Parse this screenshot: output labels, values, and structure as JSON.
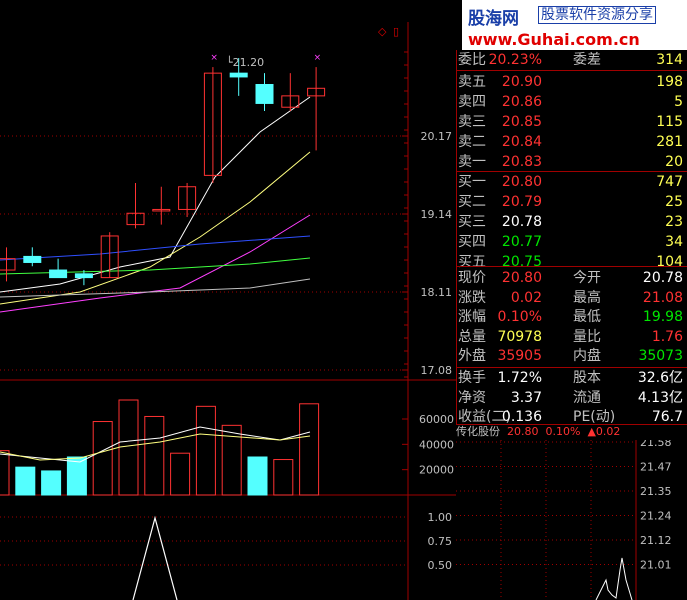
{
  "logo": {
    "brand": "股海网",
    "slogan": "股票软件资源分享",
    "url": "www.Guhai.com.cn"
  },
  "toolbar": {
    "diamond_glyph": "◇",
    "pane_glyph": "▯"
  },
  "price_chart": {
    "y_axis_labels": [
      "20.17",
      "19.14",
      "18.11",
      "17.08"
    ],
    "peak_annotation": "21.20",
    "candles": [
      {
        "o": 18.4,
        "h": 18.7,
        "l": 18.25,
        "c": 18.55
      },
      {
        "o": 18.58,
        "h": 18.7,
        "l": 18.45,
        "c": 18.5
      },
      {
        "o": 18.4,
        "h": 18.55,
        "l": 18.3,
        "c": 18.3
      },
      {
        "o": 18.35,
        "h": 18.4,
        "l": 18.2,
        "c": 18.3
      },
      {
        "o": 18.3,
        "h": 18.9,
        "l": 18.3,
        "c": 18.85
      },
      {
        "o": 19.0,
        "h": 19.55,
        "l": 18.95,
        "c": 19.15
      },
      {
        "o": 19.2,
        "h": 19.5,
        "l": 19.0,
        "c": 19.2
      },
      {
        "o": 19.2,
        "h": 19.55,
        "l": 19.1,
        "c": 19.5
      },
      {
        "o": 19.65,
        "h": 21.08,
        "l": 19.55,
        "c": 21.0
      },
      {
        "o": 21.0,
        "h": 21.2,
        "l": 20.7,
        "c": 20.95
      },
      {
        "o": 20.85,
        "h": 21.0,
        "l": 20.5,
        "c": 20.6
      },
      {
        "o": 20.55,
        "h": 21.0,
        "l": 20.5,
        "c": 20.7
      },
      {
        "o": 20.7,
        "h": 21.08,
        "l": 19.98,
        "c": 20.8
      }
    ]
  },
  "volume_chart": {
    "y_axis_labels": [
      "60000",
      "40000",
      "20000"
    ],
    "bars": [
      {
        "v": 35000,
        "up": true
      },
      {
        "v": 22000,
        "up": false
      },
      {
        "v": 19000,
        "up": false
      },
      {
        "v": 30000,
        "up": false
      },
      {
        "v": 58000,
        "up": true
      },
      {
        "v": 75000,
        "up": true
      },
      {
        "v": 62000,
        "up": true
      },
      {
        "v": 33000,
        "up": true
      },
      {
        "v": 70000,
        "up": true
      },
      {
        "v": 55000,
        "up": true
      },
      {
        "v": 30000,
        "up": false
      },
      {
        "v": 28000,
        "up": true
      },
      {
        "v": 72000,
        "up": true
      }
    ]
  },
  "indicator_chart": {
    "y_axis_labels": [
      "1.00",
      "0.75",
      "0.50"
    ]
  },
  "quote_panel": {
    "partial_row": {
      "label": "委比",
      "value": "20.23%",
      "label2": "委差",
      "value2": "314"
    },
    "sell_orders": [
      {
        "label": "卖五",
        "price": "20.90",
        "qty": "198"
      },
      {
        "label": "卖四",
        "price": "20.86",
        "qty": "5"
      },
      {
        "label": "卖三",
        "price": "20.85",
        "qty": "115"
      },
      {
        "label": "卖二",
        "price": "20.84",
        "qty": "281"
      },
      {
        "label": "卖一",
        "price": "20.83",
        "qty": "20"
      }
    ],
    "buy_orders": [
      {
        "label": "买一",
        "price": "20.80",
        "qty": "747",
        "color": "#ff3232"
      },
      {
        "label": "买二",
        "price": "20.79",
        "qty": "25",
        "color": "#ff3232"
      },
      {
        "label": "买三",
        "price": "20.78",
        "qty": "23",
        "color": "#ffffff"
      },
      {
        "label": "买四",
        "price": "20.77",
        "qty": "34",
        "color": "#00e600"
      },
      {
        "label": "买五",
        "price": "20.75",
        "qty": "104",
        "color": "#00e600"
      }
    ],
    "stats": [
      {
        "label": "现价",
        "value": "20.80",
        "label2": "今开",
        "value2": "20.78",
        "c1": "#ff3232",
        "c2": "#ffffff"
      },
      {
        "label": "涨跌",
        "value": "0.02",
        "label2": "最高",
        "value2": "21.08",
        "c1": "#ff3232",
        "c2": "#ff3232"
      },
      {
        "label": "涨幅",
        "value": "0.10%",
        "label2": "最低",
        "value2": "19.98",
        "c1": "#ff3232",
        "c2": "#00e600"
      },
      {
        "label": "总量",
        "value": "70978",
        "label2": "量比",
        "value2": "1.76",
        "c1": "#ffff54",
        "c2": "#ff3232"
      },
      {
        "label": "外盘",
        "value": "35905",
        "label2": "内盘",
        "value2": "35073",
        "c1": "#ff3232",
        "c2": "#00e600"
      }
    ],
    "fundamentals": [
      {
        "label": "换手",
        "value": "1.72%",
        "label2": "股本",
        "value2": "32.6亿"
      },
      {
        "label": "净资",
        "value": "3.37",
        "label2": "流通",
        "value2": "4.13亿"
      },
      {
        "label": "收益(二)",
        "value": "0.136",
        "label2": "PE(动)",
        "value2": "76.7"
      }
    ]
  },
  "intraday": {
    "stock_name": "传化股份",
    "price": "20.80",
    "change_pct": "0.10%",
    "change_arrow": "▲",
    "change": "0.02",
    "y_axis_labels": [
      "21.58",
      "21.47",
      "21.35",
      "21.24",
      "21.12",
      "21.01"
    ]
  },
  "colors": {
    "up": "#ff3232",
    "down": "#54ffff",
    "axis": "#a00000",
    "bg": "#000000"
  }
}
